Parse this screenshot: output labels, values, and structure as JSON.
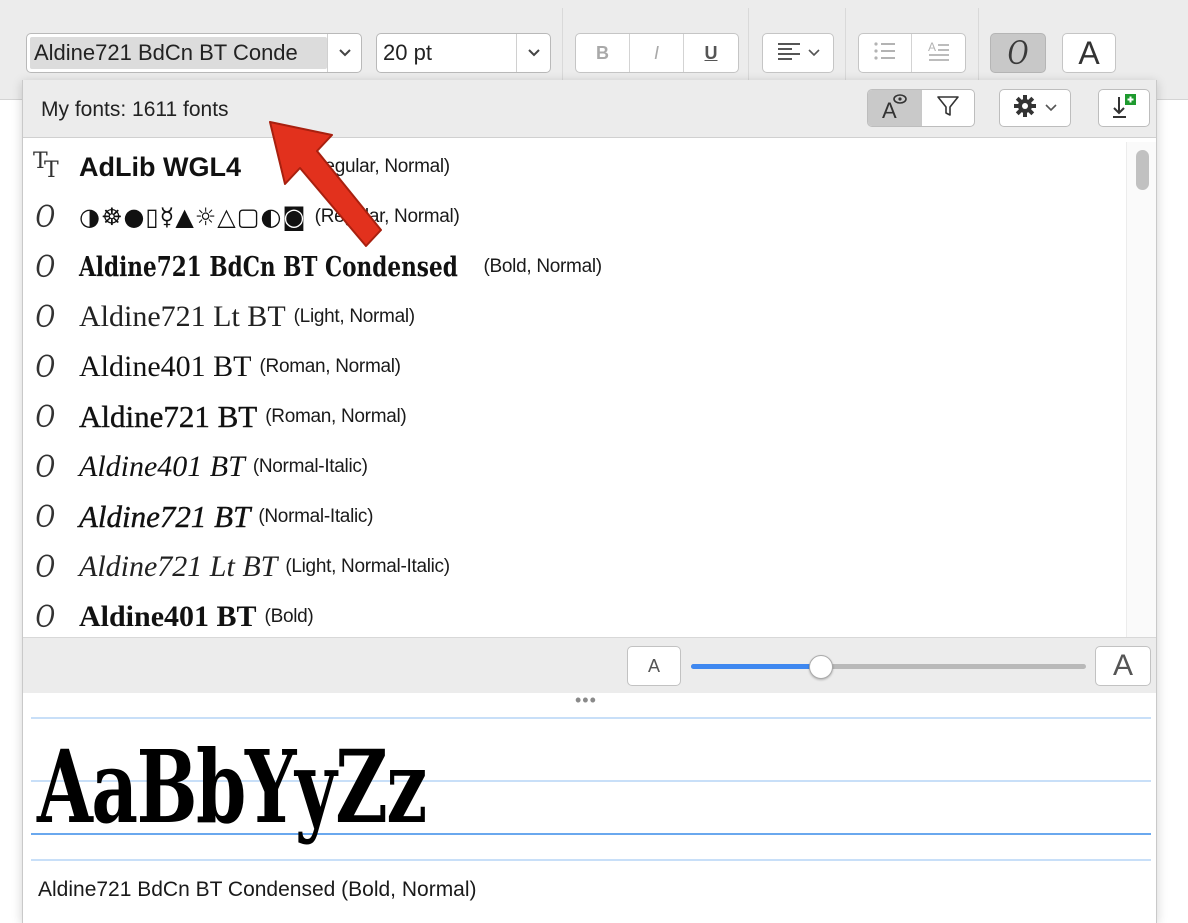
{
  "toolbar": {
    "font_name": "Aldine721 BdCn BT Conde",
    "font_size": "20 pt",
    "bold_label": "B",
    "italic_label": "I",
    "underline_label": "U",
    "font_panel_glyph": "O",
    "text_color_glyph": "A",
    "icons": {
      "font_dropdown": "chevron-down-icon",
      "size_dropdown": "chevron-down-icon",
      "align": "align-left-icon",
      "bullet_list": "bullet-list-icon",
      "line_spacing": "line-spacing-icon"
    }
  },
  "panel": {
    "font_count": "My fonts: 1611 fonts",
    "icons": {
      "preview_toggle": "font-preview-icon",
      "filter": "filter-icon",
      "settings": "gear-icon",
      "install_font": "install-font-icon"
    }
  },
  "fonts": [
    {
      "name": "AdLib WGL4",
      "style": "(Regular, Normal)",
      "icon": "truetype-icon"
    },
    {
      "name": "◑☸●▯☿▲☼△▢◐◙",
      "style": "(Regular, Normal)",
      "icon": "opentype-icon"
    },
    {
      "name": "Aldine721 BdCn BT Condensed",
      "style": "(Bold, Normal)",
      "icon": "opentype-icon"
    },
    {
      "name": "Aldine721 Lt BT",
      "style": "(Light, Normal)",
      "icon": "opentype-icon"
    },
    {
      "name": "Aldine401 BT",
      "style": "(Roman, Normal)",
      "icon": "opentype-icon"
    },
    {
      "name": "Aldine721 BT",
      "style": "(Roman, Normal)",
      "icon": "opentype-icon"
    },
    {
      "name": "Aldine401 BT",
      "style": "(Normal-Italic)",
      "icon": "opentype-icon"
    },
    {
      "name": "Aldine721 BT",
      "style": "(Normal-Italic)",
      "icon": "opentype-icon"
    },
    {
      "name": "Aldine721 Lt BT",
      "style": "(Light, Normal-Italic)",
      "icon": "opentype-icon"
    },
    {
      "name": "Aldine401 BT",
      "style": "(Bold)",
      "icon": "opentype-icon"
    }
  ],
  "size_slider": {
    "small_label": "A",
    "large_label": "A",
    "value_fraction": 0.33
  },
  "preview": {
    "sample": "AaBbYyZz",
    "caption": "Aldine721 BdCn BT Condensed (Bold, Normal)"
  },
  "colors": {
    "annotation_arrow": "#e2311d",
    "slider_fill": "#3f88f0",
    "guide_line": "#c8dff8",
    "baseline": "#6aa8ee"
  }
}
